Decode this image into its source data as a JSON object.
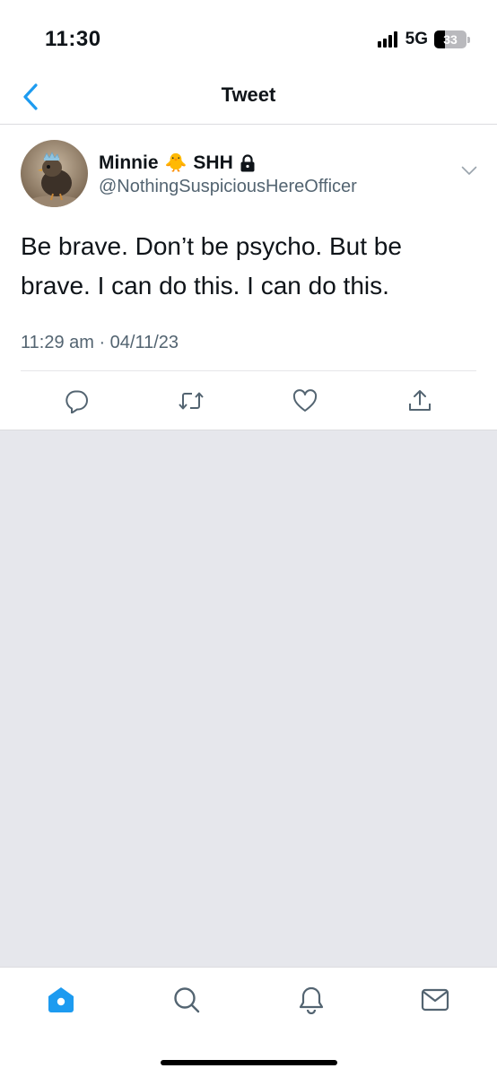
{
  "status_bar": {
    "time": "11:30",
    "network": "5G",
    "battery": "33",
    "battery_level_percent": 33
  },
  "nav": {
    "title": "Tweet",
    "back_icon": "chevron-left-icon"
  },
  "tweet": {
    "author_name": "Minnie",
    "author_emoji": "🐥",
    "author_suffix": "SHH",
    "author_lock_icon": "lock-icon",
    "handle": "@NothingSuspiciousHereOfficer",
    "text": "Be brave. Don’t be psycho. But be brave. I can do this. I can do this.",
    "timestamp": "11:29 am · 04/11/23",
    "actions": [
      "reply-icon",
      "retweet-icon",
      "like-icon",
      "share-icon"
    ]
  },
  "tabbar": {
    "tabs": [
      "home-icon",
      "search-icon",
      "notifications-icon",
      "messages-icon"
    ],
    "active_tab": "home"
  },
  "colors": {
    "accent": "#1d9bf0",
    "text": "#0f1419",
    "secondary": "#536471",
    "background": "#e6e7ec"
  }
}
